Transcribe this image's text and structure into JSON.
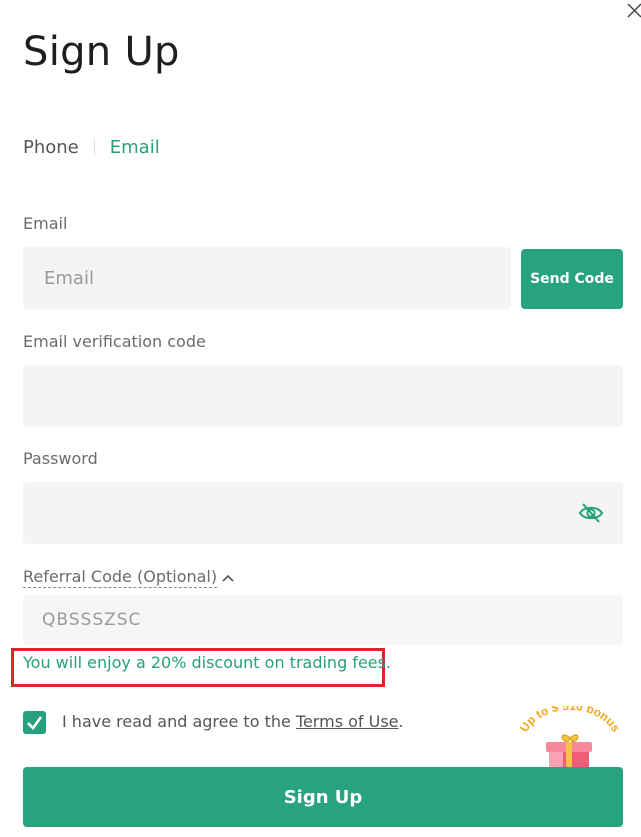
{
  "title": "Sign Up",
  "tabs": [
    {
      "label": "Phone",
      "active": false
    },
    {
      "label": "Email",
      "active": true
    }
  ],
  "email": {
    "label": "Email",
    "placeholder": "Email",
    "value": "",
    "send_code_label": "Send Code"
  },
  "verification": {
    "label": "Email verification code",
    "value": ""
  },
  "password": {
    "label": "Password",
    "value": "",
    "toggle_icon": "eye-hidden-icon"
  },
  "referral": {
    "label": "Referral Code (Optional)",
    "expanded": true,
    "placeholder": "QBSSSZSC",
    "value": ""
  },
  "discount_message": "You will enjoy a 20% discount on trading fees.",
  "agreement": {
    "checked": true,
    "text": "I have read and agree to the ",
    "link_text": "Terms of Use",
    "suffix": "."
  },
  "bonus_badge": {
    "text": "Up to $ 510 bonus",
    "icon": "gift-box-icon"
  },
  "submit_label": "Sign Up",
  "colors": {
    "accent": "#26a17b",
    "highlight_border": "#e3222a",
    "field_bg": "#f4f4f4"
  }
}
